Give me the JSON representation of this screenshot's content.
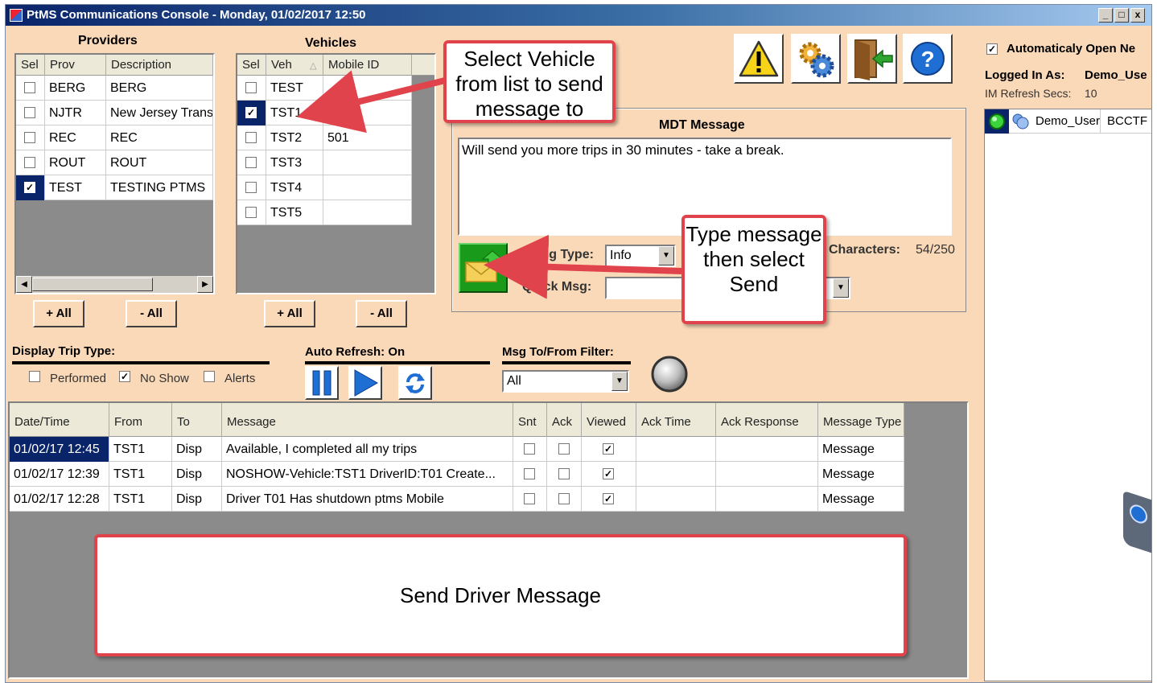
{
  "window": {
    "title": "PtMS Communications Console - Monday, 01/02/2017 12:50",
    "minimize": "_",
    "maximize": "□",
    "close": "x"
  },
  "providers": {
    "title": "Providers",
    "columns": [
      "Sel",
      "Prov",
      "Description"
    ],
    "rows": [
      {
        "checked": false,
        "prov": "BERG",
        "desc": "BERG"
      },
      {
        "checked": false,
        "prov": "NJTR",
        "desc": "New Jersey Transit"
      },
      {
        "checked": false,
        "prov": "REC",
        "desc": "REC"
      },
      {
        "checked": false,
        "prov": "ROUT",
        "desc": "ROUT"
      },
      {
        "checked": true,
        "prov": "TEST",
        "desc": "TESTING PTMS"
      }
    ],
    "add_all": "+ All",
    "remove_all": "- All"
  },
  "vehicles": {
    "title": "Vehicles",
    "columns": [
      "Sel",
      "Veh",
      "Mobile ID"
    ],
    "sort_indicator": "△",
    "rows": [
      {
        "checked": false,
        "veh": "TEST",
        "mobile": ""
      },
      {
        "checked": true,
        "veh": "TST1",
        "mobile": ""
      },
      {
        "checked": false,
        "veh": "TST2",
        "mobile": "501"
      },
      {
        "checked": false,
        "veh": "TST3",
        "mobile": ""
      },
      {
        "checked": false,
        "veh": "TST4",
        "mobile": ""
      },
      {
        "checked": false,
        "veh": "TST5",
        "mobile": ""
      }
    ],
    "add_all": "+ All",
    "remove_all": "- All"
  },
  "toolbar_icons": [
    "warning-icon",
    "settings-gears-icon",
    "exit-door-icon",
    "help-icon"
  ],
  "mdt": {
    "title": "MDT Message",
    "message": "Will send you more trips in 30 minutes - take a break.",
    "msg_type_label": "Msg Type:",
    "msg_type_value": "Info",
    "quick_msg_label": "Quick Msg:",
    "quick_msg_value": "",
    "characters_label": "Characters:",
    "characters_value": "54/250"
  },
  "right_panel": {
    "auto_open_label": "Automaticaly Open Ne",
    "auto_open_checked": true,
    "logged_in_label": "Logged In As:",
    "logged_in_user": "Demo_Use",
    "im_refresh_label": "IM Refresh Secs:",
    "im_refresh_value": "10",
    "user_row": {
      "name": "Demo_User",
      "org": "BCCTF"
    }
  },
  "trip_type": {
    "label": "Display Trip Type:",
    "options": [
      {
        "label": "Performed",
        "checked": false
      },
      {
        "label": "No Show",
        "checked": true
      },
      {
        "label": "Alerts",
        "checked": false
      }
    ]
  },
  "auto_refresh": {
    "label": "Auto Refresh: On"
  },
  "filter": {
    "label": "Msg To/From Filter:",
    "value": "All"
  },
  "messages": {
    "columns": [
      "Date/Time",
      "From",
      "To",
      "Message",
      "Snt",
      "Ack",
      "Viewed",
      "Ack Time",
      "Ack Response",
      "Message Type"
    ],
    "rows": [
      {
        "datetime": "01/02/17 12:45",
        "from": "TST1",
        "to": "Disp",
        "message": "Available, I completed all my trips",
        "snt": false,
        "ack": false,
        "viewed": true,
        "ack_time": "",
        "ack_response": "",
        "type": "Message"
      },
      {
        "datetime": "01/02/17 12:39",
        "from": "TST1",
        "to": "Disp",
        "message": "NOSHOW-Vehicle:TST1 DriverID:T01 Create...",
        "snt": false,
        "ack": false,
        "viewed": true,
        "ack_time": "",
        "ack_response": "",
        "type": "Message"
      },
      {
        "datetime": "01/02/17 12:28",
        "from": "TST1",
        "to": "Disp",
        "message": "Driver T01 Has shutdown ptms Mobile",
        "snt": false,
        "ack": false,
        "viewed": true,
        "ack_time": "",
        "ack_response": "",
        "type": "Message"
      }
    ]
  },
  "callouts": {
    "select_vehicle": "Select Vehicle from list to send message to",
    "type_message": "Type message then select Send",
    "send_driver": "Send Driver Message"
  },
  "colors": {
    "accent_red": "#e0434b",
    "selection": "#0a246a",
    "background": "#fad9b8",
    "send_button": "#1a9a1a"
  }
}
